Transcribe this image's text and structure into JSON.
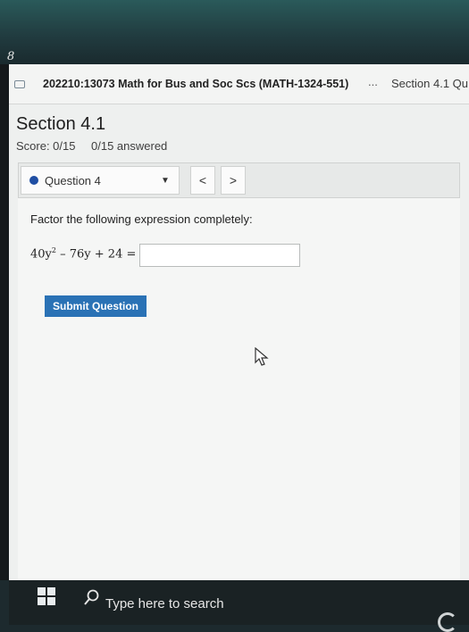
{
  "bezel": {
    "mark": "8"
  },
  "header": {
    "course_title": "202210:13073 Math for Bus and Soc Scs (MATH-1324-551)",
    "more_label": "...",
    "section_tab": "Section 4.1 Qu"
  },
  "assignment": {
    "title": "Section 4.1",
    "score": "Score: 0/15",
    "answered": "0/15 answered"
  },
  "question_nav": {
    "selected": "Question 4",
    "status_color": "#1f4ea3",
    "prev_label": "<",
    "next_label": ">"
  },
  "question": {
    "prompt": "Factor the following expression completely:",
    "expr_coef": "40y",
    "expr_exp": "2",
    "expr_rest": " – 76y + 24 =",
    "answer_value": ""
  },
  "submit_label": "Submit Question",
  "accent_color": "#2a72b5",
  "taskbar": {
    "search_placeholder": "Type here to search"
  }
}
